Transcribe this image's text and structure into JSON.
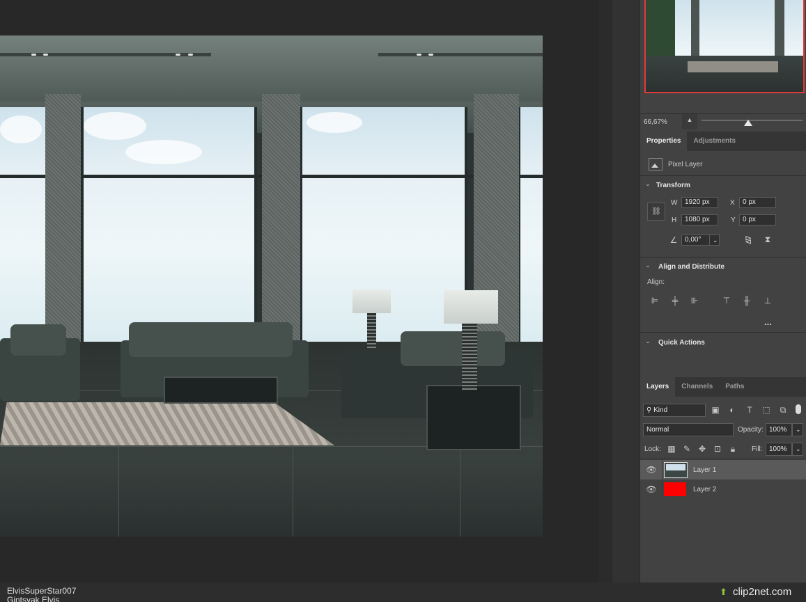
{
  "navigator": {
    "zoom": "66,67%"
  },
  "properties": {
    "tabs": [
      {
        "label": "Properties"
      },
      {
        "label": "Adjustments"
      }
    ],
    "layer_type": "Pixel Layer",
    "transform": {
      "title": "Transform",
      "w_label": "W",
      "w_value": "1920 px",
      "h_label": "H",
      "h_value": "1080 px",
      "x_label": "X",
      "x_value": "0 px",
      "y_label": "Y",
      "y_value": "0 px",
      "angle_value": "0,00°"
    },
    "align": {
      "title": "Align and Distribute",
      "align_label": "Align:",
      "more": "..."
    },
    "quick_actions": {
      "title": "Quick Actions"
    }
  },
  "layers_panel": {
    "tabs": [
      {
        "label": "Layers"
      },
      {
        "label": "Channels"
      },
      {
        "label": "Paths"
      }
    ],
    "filter_kind": "Kind",
    "blend_mode": "Normal",
    "opacity_label": "Opacity:",
    "opacity_value": "100%",
    "lock_label": "Lock:",
    "fill_label": "Fill:",
    "fill_value": "100%",
    "layers": [
      {
        "name": "Layer 1",
        "thumb_color": "#3d4846"
      },
      {
        "name": "Layer 2",
        "thumb_color": "#ff0000"
      }
    ]
  },
  "footer": {
    "credit_line1": "ElvisSuperStar007",
    "credit_line2": "Gintsyak Elvis",
    "watermark": "clip2net.com"
  },
  "colors": {
    "accent_red": "#e03a3a",
    "panel_bg": "#424242"
  }
}
